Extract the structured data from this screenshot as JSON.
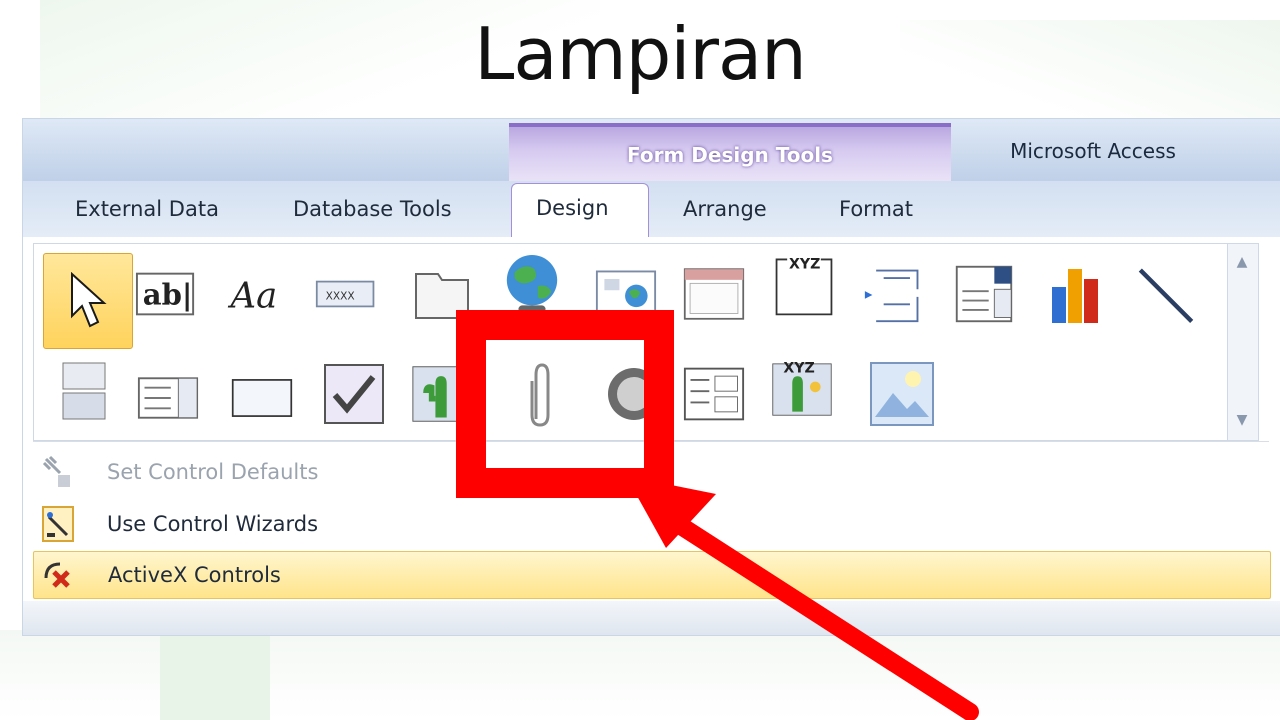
{
  "slide": {
    "title": "Lampiran"
  },
  "window": {
    "app_title": "Microsoft Access",
    "context_group": "Form Design Tools"
  },
  "tabs": [
    {
      "label": "External Data"
    },
    {
      "label": "Database Tools"
    },
    {
      "label": "Design"
    },
    {
      "label": "Arrange"
    },
    {
      "label": "Format"
    }
  ],
  "controls": {
    "row1": [
      "select-pointer-icon",
      "textbox-icon",
      "label-icon",
      "button-icon",
      "tab-control-icon",
      "hyperlink-icon",
      "web-browser-icon",
      "navigation-control-icon",
      "option-group-icon",
      "page-break-icon",
      "combo-box-icon",
      "chart-icon",
      "line-icon"
    ],
    "row2": [
      "toggle-button-icon",
      "list-box-icon",
      "rectangle-icon",
      "check-box-icon",
      "unbound-object-frame-icon",
      "attachment-icon",
      "option-button-icon",
      "subform-icon",
      "bound-object-frame-icon",
      "image-icon"
    ],
    "glyphs": {
      "textbox": "ab|",
      "label": "Aa",
      "button": "XXXX",
      "xyz": "XYZ"
    }
  },
  "menu": {
    "items": [
      {
        "label": "Set Control Defaults",
        "enabled": false
      },
      {
        "label": "Use Control Wizards",
        "enabled": true
      },
      {
        "label": "ActiveX Controls",
        "enabled": true
      }
    ]
  },
  "annotation": {
    "color": "#ff0000",
    "target": "attachment-icon"
  },
  "colors": {
    "context_accent": "#8a6dc9",
    "selection": "#ffd35c"
  }
}
